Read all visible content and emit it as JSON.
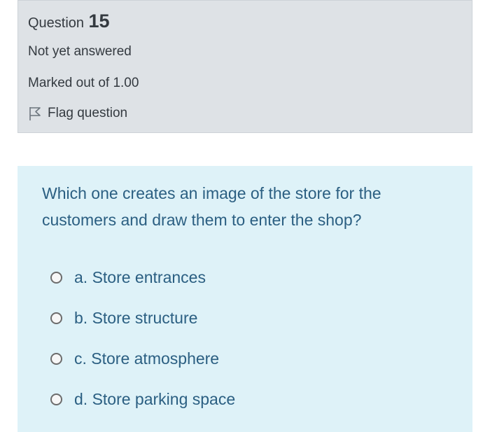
{
  "question_info": {
    "question_word": "Question",
    "question_number": "15",
    "state": "Not yet answered",
    "grade": "Marked out of 1.00",
    "flag_label": "Flag question",
    "flag_icon": "flag-outline-icon"
  },
  "question": {
    "text": "Which one creates an image of the store for the customers and draw them to enter the shop?",
    "answers": [
      {
        "label": "a. Store entrances",
        "selected": false
      },
      {
        "label": "b. Store structure",
        "selected": false
      },
      {
        "label": "c. Store atmosphere",
        "selected": false
      },
      {
        "label": "d. Store parking space",
        "selected": false
      }
    ]
  },
  "colors": {
    "info_background": "#dee2e6",
    "formulation_background": "#def2f8",
    "question_text": "#2b5f82",
    "info_text": "#343a40"
  }
}
